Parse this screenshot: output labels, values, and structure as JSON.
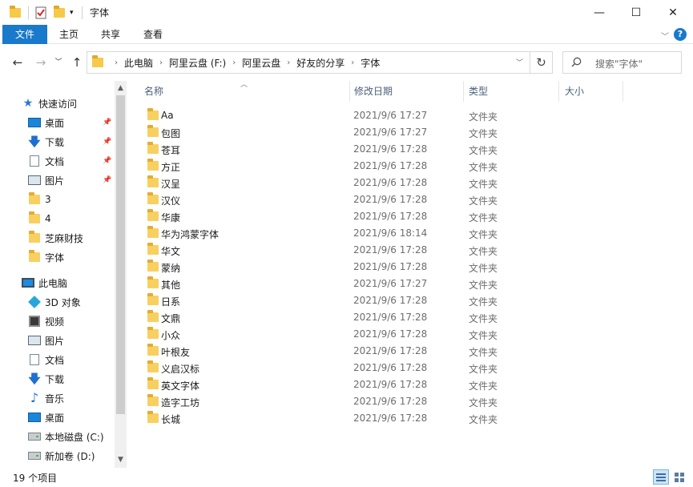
{
  "window": {
    "title": "字体",
    "minimize_glyph": "—",
    "maximize_glyph": "☐",
    "close_glyph": "✕"
  },
  "ribbon": {
    "tabs": [
      "文件",
      "主页",
      "共享",
      "查看"
    ],
    "help_glyph": "?"
  },
  "address": {
    "crumbs": [
      "此电脑",
      "阿里云盘 (F:)",
      "阿里云盘",
      "好友的分享",
      "字体"
    ],
    "search_placeholder": "搜索\"字体\""
  },
  "sidebar": {
    "quick_access": "快速访问",
    "pinned": [
      {
        "label": "桌面",
        "icon": "desktop-icon"
      },
      {
        "label": "下载",
        "icon": "download-icon"
      },
      {
        "label": "文档",
        "icon": "document-icon"
      },
      {
        "label": "图片",
        "icon": "picture-icon"
      }
    ],
    "recent": [
      "3",
      "4",
      "芝麻财技",
      "字体"
    ],
    "this_pc": "此电脑",
    "pc_items": [
      {
        "label": "3D 对象",
        "icon": "3d-objects-icon"
      },
      {
        "label": "视频",
        "icon": "video-icon"
      },
      {
        "label": "图片",
        "icon": "picture-icon"
      },
      {
        "label": "文档",
        "icon": "document-icon"
      },
      {
        "label": "下载",
        "icon": "download-icon"
      },
      {
        "label": "音乐",
        "icon": "music-icon"
      },
      {
        "label": "桌面",
        "icon": "desktop-icon"
      },
      {
        "label": "本地磁盘 (C:)",
        "icon": "drive-icon"
      },
      {
        "label": "新加卷 (D:)",
        "icon": "drive-icon"
      }
    ]
  },
  "columns": {
    "name": "名称",
    "date": "修改日期",
    "type": "类型",
    "size": "大小"
  },
  "files": [
    {
      "name": "Aa",
      "date": "2021/9/6 17:27",
      "type": "文件夹"
    },
    {
      "name": "包图",
      "date": "2021/9/6 17:27",
      "type": "文件夹"
    },
    {
      "name": "苍耳",
      "date": "2021/9/6 17:28",
      "type": "文件夹"
    },
    {
      "name": "方正",
      "date": "2021/9/6 17:28",
      "type": "文件夹"
    },
    {
      "name": "汉呈",
      "date": "2021/9/6 17:28",
      "type": "文件夹"
    },
    {
      "name": "汉仪",
      "date": "2021/9/6 17:28",
      "type": "文件夹"
    },
    {
      "name": "华康",
      "date": "2021/9/6 17:28",
      "type": "文件夹"
    },
    {
      "name": "华为鸿蒙字体",
      "date": "2021/9/6 18:14",
      "type": "文件夹"
    },
    {
      "name": "华文",
      "date": "2021/9/6 17:28",
      "type": "文件夹"
    },
    {
      "name": "蒙纳",
      "date": "2021/9/6 17:28",
      "type": "文件夹"
    },
    {
      "name": "其他",
      "date": "2021/9/6 17:27",
      "type": "文件夹"
    },
    {
      "name": "日系",
      "date": "2021/9/6 17:28",
      "type": "文件夹"
    },
    {
      "name": "文鼎",
      "date": "2021/9/6 17:28",
      "type": "文件夹"
    },
    {
      "name": "小众",
      "date": "2021/9/6 17:28",
      "type": "文件夹"
    },
    {
      "name": "叶根友",
      "date": "2021/9/6 17:28",
      "type": "文件夹"
    },
    {
      "name": "义启汉标",
      "date": "2021/9/6 17:28",
      "type": "文件夹"
    },
    {
      "name": "英文字体",
      "date": "2021/9/6 17:28",
      "type": "文件夹"
    },
    {
      "name": "造字工坊",
      "date": "2021/9/6 17:28",
      "type": "文件夹"
    },
    {
      "name": "长城",
      "date": "2021/9/6 17:28",
      "type": "文件夹"
    }
  ],
  "status": {
    "count": "19 个项目"
  },
  "colors": {
    "accent": "#1979ca",
    "folder": "#f8d061"
  }
}
